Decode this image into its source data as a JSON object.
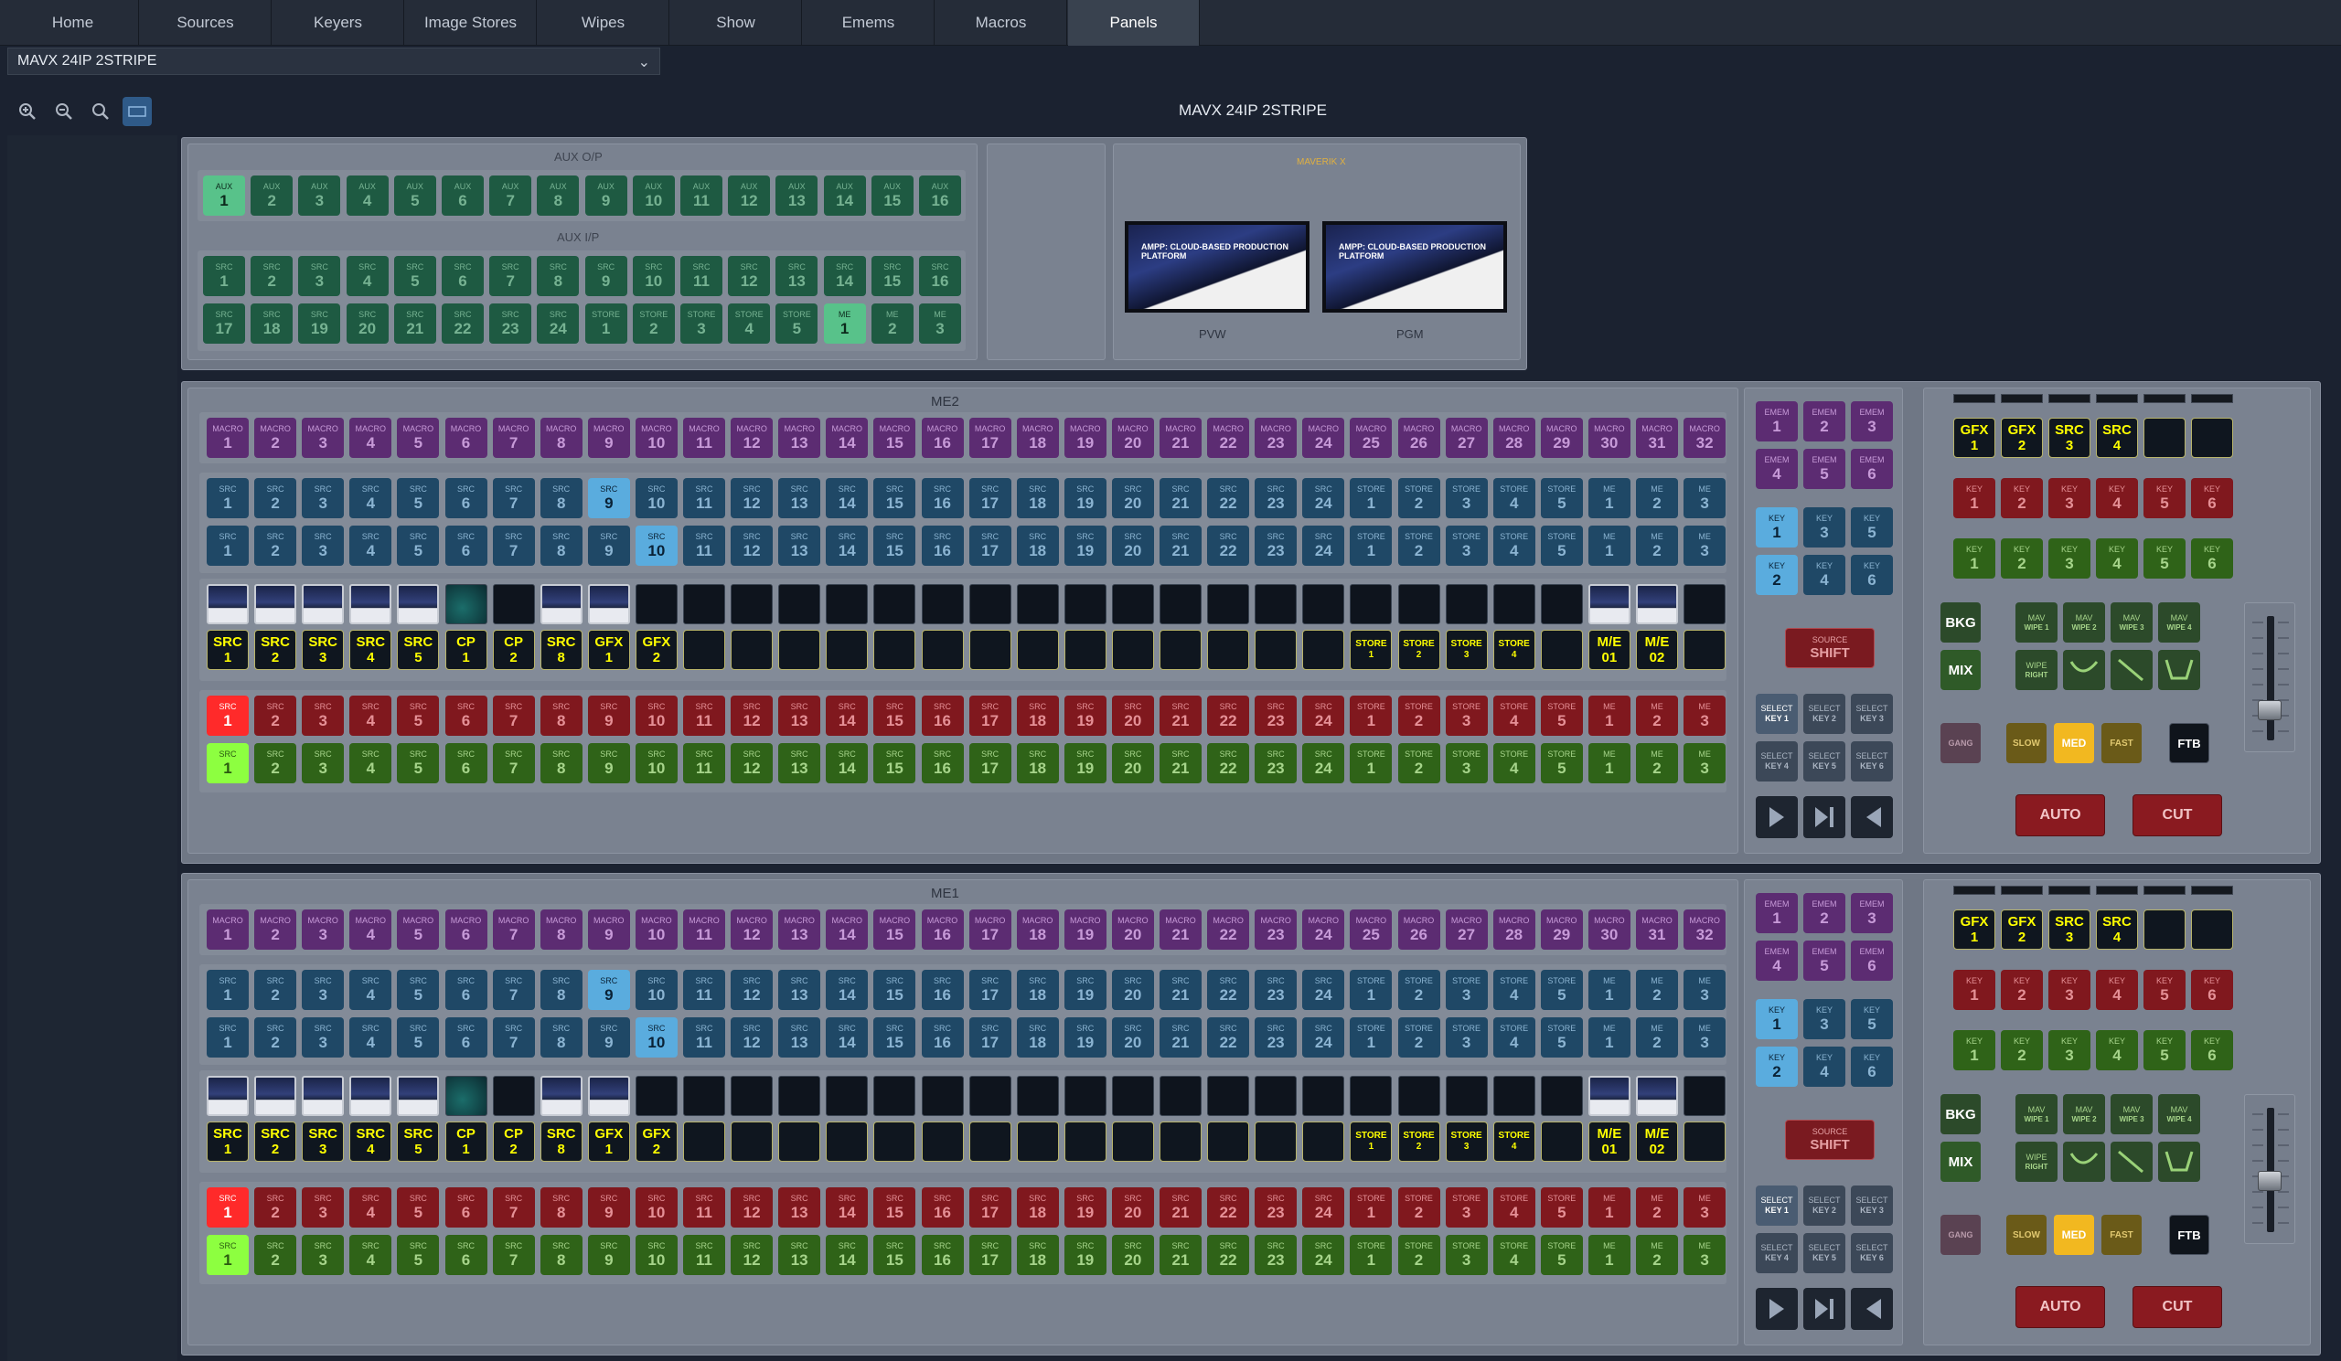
{
  "nav": {
    "tabs": [
      "Home",
      "Sources",
      "Keyers",
      "Image Stores",
      "Wipes",
      "Show",
      "Emems",
      "Macros",
      "Panels"
    ],
    "active": "Panels"
  },
  "panel_selector": {
    "value": "MAVX 24IP 2STRIPE"
  },
  "title": "MAVX 24IP 2STRIPE",
  "zoom_icons": [
    "zoom-in-icon",
    "zoom-out-icon",
    "zoom-reset-icon",
    "fit-icon"
  ],
  "aux": {
    "out_label": "AUX O/P",
    "in_label": "AUX I/P",
    "out_buttons": [
      [
        "AUX",
        "1"
      ],
      [
        "AUX",
        "2"
      ],
      [
        "AUX",
        "3"
      ],
      [
        "AUX",
        "4"
      ],
      [
        "AUX",
        "5"
      ],
      [
        "AUX",
        "6"
      ],
      [
        "AUX",
        "7"
      ],
      [
        "AUX",
        "8"
      ],
      [
        "AUX",
        "9"
      ],
      [
        "AUX",
        "10"
      ],
      [
        "AUX",
        "11"
      ],
      [
        "AUX",
        "12"
      ],
      [
        "AUX",
        "13"
      ],
      [
        "AUX",
        "14"
      ],
      [
        "AUX",
        "15"
      ],
      [
        "AUX",
        "16"
      ]
    ],
    "in_row1": [
      [
        "SRC",
        "1"
      ],
      [
        "SRC",
        "2"
      ],
      [
        "SRC",
        "3"
      ],
      [
        "SRC",
        "4"
      ],
      [
        "SRC",
        "5"
      ],
      [
        "SRC",
        "6"
      ],
      [
        "SRC",
        "7"
      ],
      [
        "SRC",
        "8"
      ],
      [
        "SRC",
        "9"
      ],
      [
        "SRC",
        "10"
      ],
      [
        "SRC",
        "11"
      ],
      [
        "SRC",
        "12"
      ],
      [
        "SRC",
        "13"
      ],
      [
        "SRC",
        "14"
      ],
      [
        "SRC",
        "15"
      ],
      [
        "SRC",
        "16"
      ]
    ],
    "in_row2": [
      [
        "SRC",
        "17"
      ],
      [
        "SRC",
        "18"
      ],
      [
        "SRC",
        "19"
      ],
      [
        "SRC",
        "20"
      ],
      [
        "SRC",
        "21"
      ],
      [
        "SRC",
        "22"
      ],
      [
        "SRC",
        "23"
      ],
      [
        "SRC",
        "24"
      ],
      [
        "STORE",
        "1"
      ],
      [
        "STORE",
        "2"
      ],
      [
        "STORE",
        "3"
      ],
      [
        "STORE",
        "4"
      ],
      [
        "STORE",
        "5"
      ],
      [
        "ME",
        "1"
      ],
      [
        "ME",
        "2"
      ],
      [
        "ME",
        "3"
      ]
    ],
    "out_selected": 0,
    "in_selected": 13
  },
  "maverik": {
    "label": "MAVERIK X",
    "pvw": "PVW",
    "pgm": "PGM",
    "thumb_text": "AMPP: CLOUD-BASED PRODUCTION PLATFORM"
  },
  "mes": [
    {
      "label": "ME2",
      "macros": [
        [
          "MACRO",
          "1"
        ],
        [
          "MACRO",
          "2"
        ],
        [
          "MACRO",
          "3"
        ],
        [
          "MACRO",
          "4"
        ],
        [
          "MACRO",
          "5"
        ],
        [
          "MACRO",
          "6"
        ],
        [
          "MACRO",
          "7"
        ],
        [
          "MACRO",
          "8"
        ],
        [
          "MACRO",
          "9"
        ],
        [
          "MACRO",
          "10"
        ],
        [
          "MACRO",
          "11"
        ],
        [
          "MACRO",
          "12"
        ],
        [
          "MACRO",
          "13"
        ],
        [
          "MACRO",
          "14"
        ],
        [
          "MACRO",
          "15"
        ],
        [
          "MACRO",
          "16"
        ],
        [
          "MACRO",
          "17"
        ],
        [
          "MACRO",
          "18"
        ],
        [
          "MACRO",
          "19"
        ],
        [
          "MACRO",
          "20"
        ],
        [
          "MACRO",
          "21"
        ],
        [
          "MACRO",
          "22"
        ],
        [
          "MACRO",
          "23"
        ],
        [
          "MACRO",
          "24"
        ],
        [
          "MACRO",
          "25"
        ],
        [
          "MACRO",
          "26"
        ],
        [
          "MACRO",
          "27"
        ],
        [
          "MACRO",
          "28"
        ],
        [
          "MACRO",
          "29"
        ],
        [
          "MACRO",
          "30"
        ],
        [
          "MACRO",
          "31"
        ],
        [
          "MACRO",
          "32"
        ]
      ],
      "bus": [
        [
          "SRC",
          "1"
        ],
        [
          "SRC",
          "2"
        ],
        [
          "SRC",
          "3"
        ],
        [
          "SRC",
          "4"
        ],
        [
          "SRC",
          "5"
        ],
        [
          "SRC",
          "6"
        ],
        [
          "SRC",
          "7"
        ],
        [
          "SRC",
          "8"
        ],
        [
          "SRC",
          "9"
        ],
        [
          "SRC",
          "10"
        ],
        [
          "SRC",
          "11"
        ],
        [
          "SRC",
          "12"
        ],
        [
          "SRC",
          "13"
        ],
        [
          "SRC",
          "14"
        ],
        [
          "SRC",
          "15"
        ],
        [
          "SRC",
          "16"
        ],
        [
          "SRC",
          "17"
        ],
        [
          "SRC",
          "18"
        ],
        [
          "SRC",
          "19"
        ],
        [
          "SRC",
          "20"
        ],
        [
          "SRC",
          "21"
        ],
        [
          "SRC",
          "22"
        ],
        [
          "SRC",
          "23"
        ],
        [
          "SRC",
          "24"
        ],
        [
          "STORE",
          "1"
        ],
        [
          "STORE",
          "2"
        ],
        [
          "STORE",
          "3"
        ],
        [
          "STORE",
          "4"
        ],
        [
          "STORE",
          "5"
        ],
        [
          "ME",
          "1"
        ],
        [
          "ME",
          "2"
        ],
        [
          "ME",
          "3"
        ]
      ],
      "key1_selected": 8,
      "key2_selected": 9,
      "thumbs": [
        "img",
        "img",
        "img",
        "img",
        "img",
        "teal",
        "",
        "img",
        "img",
        "",
        "",
        "",
        "",
        "",
        "",
        "",
        "",
        "",
        "",
        "",
        "",
        "",
        "",
        "",
        "",
        "",
        "",
        "",
        "",
        "img",
        "img",
        ""
      ],
      "labels": [
        [
          "SRC",
          "1"
        ],
        [
          "SRC",
          "2"
        ],
        [
          "SRC",
          "3"
        ],
        [
          "SRC",
          "4"
        ],
        [
          "SRC",
          "5"
        ],
        [
          "CP",
          "1"
        ],
        [
          "CP",
          "2"
        ],
        [
          "SRC",
          "8"
        ],
        [
          "GFX",
          "1"
        ],
        [
          "GFX",
          "2"
        ],
        [
          "",
          ""
        ],
        [
          "",
          ""
        ],
        [
          "",
          ""
        ],
        [
          "",
          ""
        ],
        [
          "",
          ""
        ],
        [
          "",
          ""
        ],
        [
          "",
          ""
        ],
        [
          "",
          ""
        ],
        [
          "",
          ""
        ],
        [
          "",
          ""
        ],
        [
          "",
          ""
        ],
        [
          "",
          ""
        ],
        [
          "",
          ""
        ],
        [
          "",
          ""
        ],
        [
          "STORE",
          "1"
        ],
        [
          "STORE",
          "2"
        ],
        [
          "STORE",
          "3"
        ],
        [
          "STORE",
          "4"
        ],
        [
          "",
          ""
        ],
        [
          "M/E",
          "01"
        ],
        [
          "M/E",
          "02"
        ],
        [
          "",
          ""
        ]
      ],
      "emem": [
        [
          "EMEM",
          "1"
        ],
        [
          "EMEM",
          "2"
        ],
        [
          "EMEM",
          "3"
        ],
        [
          "EMEM",
          "4"
        ],
        [
          "EMEM",
          "5"
        ],
        [
          "EMEM",
          "6"
        ]
      ],
      "keys": [
        [
          "KEY",
          "1"
        ],
        [
          "KEY",
          "3"
        ],
        [
          "KEY",
          "5"
        ],
        [
          "KEY",
          "2"
        ],
        [
          "KEY",
          "4"
        ],
        [
          "KEY",
          "6"
        ]
      ],
      "shift": [
        "SOURCE",
        "SHIFT"
      ],
      "select_keys": [
        [
          "SELECT",
          "KEY 1"
        ],
        [
          "SELECT",
          "KEY 2"
        ],
        [
          "SELECT",
          "KEY 3"
        ],
        [
          "SELECT",
          "KEY 4"
        ],
        [
          "SELECT",
          "KEY 5"
        ],
        [
          "SELECT",
          "KEY 6"
        ]
      ],
      "top_row": [
        [
          "GFX",
          "1"
        ],
        [
          "GFX",
          "2"
        ],
        [
          "SRC",
          "3"
        ],
        [
          "SRC",
          "4"
        ],
        [
          "",
          ""
        ],
        [
          "",
          ""
        ]
      ],
      "key_red": [
        [
          "KEY",
          "1"
        ],
        [
          "KEY",
          "2"
        ],
        [
          "KEY",
          "3"
        ],
        [
          "KEY",
          "4"
        ],
        [
          "KEY",
          "5"
        ],
        [
          "KEY",
          "6"
        ]
      ],
      "key_green": [
        [
          "KEY",
          "1"
        ],
        [
          "KEY",
          "2"
        ],
        [
          "KEY",
          "3"
        ],
        [
          "KEY",
          "4"
        ],
        [
          "KEY",
          "5"
        ],
        [
          "KEY",
          "6"
        ]
      ],
      "bkg": "BKG",
      "mix": "MIX",
      "mav_wipes": [
        [
          "MAV",
          "WIPE 1"
        ],
        [
          "MAV",
          "WIPE 2"
        ],
        [
          "MAV",
          "WIPE 3"
        ],
        [
          "MAV",
          "WIPE 4"
        ]
      ],
      "wipe_right": [
        "WIPE",
        "RIGHT"
      ],
      "gang": "GANG",
      "slow": "SLOW",
      "med": "MED",
      "fast": "FAST",
      "ftb": "FTB",
      "auto": "AUTO",
      "cut": "CUT",
      "fader_level": 0.2
    },
    {
      "label": "ME1",
      "macros": [
        [
          "MACRO",
          "1"
        ],
        [
          "MACRO",
          "2"
        ],
        [
          "MACRO",
          "3"
        ],
        [
          "MACRO",
          "4"
        ],
        [
          "MACRO",
          "5"
        ],
        [
          "MACRO",
          "6"
        ],
        [
          "MACRO",
          "7"
        ],
        [
          "MACRO",
          "8"
        ],
        [
          "MACRO",
          "9"
        ],
        [
          "MACRO",
          "10"
        ],
        [
          "MACRO",
          "11"
        ],
        [
          "MACRO",
          "12"
        ],
        [
          "MACRO",
          "13"
        ],
        [
          "MACRO",
          "14"
        ],
        [
          "MACRO",
          "15"
        ],
        [
          "MACRO",
          "16"
        ],
        [
          "MACRO",
          "17"
        ],
        [
          "MACRO",
          "18"
        ],
        [
          "MACRO",
          "19"
        ],
        [
          "MACRO",
          "20"
        ],
        [
          "MACRO",
          "21"
        ],
        [
          "MACRO",
          "22"
        ],
        [
          "MACRO",
          "23"
        ],
        [
          "MACRO",
          "24"
        ],
        [
          "MACRO",
          "25"
        ],
        [
          "MACRO",
          "26"
        ],
        [
          "MACRO",
          "27"
        ],
        [
          "MACRO",
          "28"
        ],
        [
          "MACRO",
          "29"
        ],
        [
          "MACRO",
          "30"
        ],
        [
          "MACRO",
          "31"
        ],
        [
          "MACRO",
          "32"
        ]
      ],
      "bus": [
        [
          "SRC",
          "1"
        ],
        [
          "SRC",
          "2"
        ],
        [
          "SRC",
          "3"
        ],
        [
          "SRC",
          "4"
        ],
        [
          "SRC",
          "5"
        ],
        [
          "SRC",
          "6"
        ],
        [
          "SRC",
          "7"
        ],
        [
          "SRC",
          "8"
        ],
        [
          "SRC",
          "9"
        ],
        [
          "SRC",
          "10"
        ],
        [
          "SRC",
          "11"
        ],
        [
          "SRC",
          "12"
        ],
        [
          "SRC",
          "13"
        ],
        [
          "SRC",
          "14"
        ],
        [
          "SRC",
          "15"
        ],
        [
          "SRC",
          "16"
        ],
        [
          "SRC",
          "17"
        ],
        [
          "SRC",
          "18"
        ],
        [
          "SRC",
          "19"
        ],
        [
          "SRC",
          "20"
        ],
        [
          "SRC",
          "21"
        ],
        [
          "SRC",
          "22"
        ],
        [
          "SRC",
          "23"
        ],
        [
          "SRC",
          "24"
        ],
        [
          "STORE",
          "1"
        ],
        [
          "STORE",
          "2"
        ],
        [
          "STORE",
          "3"
        ],
        [
          "STORE",
          "4"
        ],
        [
          "STORE",
          "5"
        ],
        [
          "ME",
          "1"
        ],
        [
          "ME",
          "2"
        ],
        [
          "ME",
          "3"
        ]
      ],
      "key1_selected": 8,
      "key2_selected": 9,
      "thumbs": [
        "img",
        "img",
        "img",
        "img",
        "img",
        "teal",
        "",
        "img",
        "img",
        "",
        "",
        "",
        "",
        "",
        "",
        "",
        "",
        "",
        "",
        "",
        "",
        "",
        "",
        "",
        "",
        "",
        "",
        "",
        "",
        "img",
        "img",
        ""
      ],
      "labels": [
        [
          "SRC",
          "1"
        ],
        [
          "SRC",
          "2"
        ],
        [
          "SRC",
          "3"
        ],
        [
          "SRC",
          "4"
        ],
        [
          "SRC",
          "5"
        ],
        [
          "CP",
          "1"
        ],
        [
          "CP",
          "2"
        ],
        [
          "SRC",
          "8"
        ],
        [
          "GFX",
          "1"
        ],
        [
          "GFX",
          "2"
        ],
        [
          "",
          ""
        ],
        [
          "",
          ""
        ],
        [
          "",
          ""
        ],
        [
          "",
          ""
        ],
        [
          "",
          ""
        ],
        [
          "",
          ""
        ],
        [
          "",
          ""
        ],
        [
          "",
          ""
        ],
        [
          "",
          ""
        ],
        [
          "",
          ""
        ],
        [
          "",
          ""
        ],
        [
          "",
          ""
        ],
        [
          "",
          ""
        ],
        [
          "",
          ""
        ],
        [
          "STORE",
          "1"
        ],
        [
          "STORE",
          "2"
        ],
        [
          "STORE",
          "3"
        ],
        [
          "STORE",
          "4"
        ],
        [
          "",
          ""
        ],
        [
          "M/E",
          "01"
        ],
        [
          "M/E",
          "02"
        ],
        [
          "",
          ""
        ]
      ],
      "emem": [
        [
          "EMEM",
          "1"
        ],
        [
          "EMEM",
          "2"
        ],
        [
          "EMEM",
          "3"
        ],
        [
          "EMEM",
          "4"
        ],
        [
          "EMEM",
          "5"
        ],
        [
          "EMEM",
          "6"
        ]
      ],
      "keys": [
        [
          "KEY",
          "1"
        ],
        [
          "KEY",
          "3"
        ],
        [
          "KEY",
          "5"
        ],
        [
          "KEY",
          "2"
        ],
        [
          "KEY",
          "4"
        ],
        [
          "KEY",
          "6"
        ]
      ],
      "shift": [
        "SOURCE",
        "SHIFT"
      ],
      "select_keys": [
        [
          "SELECT",
          "KEY 1"
        ],
        [
          "SELECT",
          "KEY 2"
        ],
        [
          "SELECT",
          "KEY 3"
        ],
        [
          "SELECT",
          "KEY 4"
        ],
        [
          "SELECT",
          "KEY 5"
        ],
        [
          "SELECT",
          "KEY 6"
        ]
      ],
      "top_row": [
        [
          "GFX",
          "1"
        ],
        [
          "GFX",
          "2"
        ],
        [
          "SRC",
          "3"
        ],
        [
          "SRC",
          "4"
        ],
        [
          "",
          ""
        ],
        [
          "",
          ""
        ]
      ],
      "key_red": [
        [
          "KEY",
          "1"
        ],
        [
          "KEY",
          "2"
        ],
        [
          "KEY",
          "3"
        ],
        [
          "KEY",
          "4"
        ],
        [
          "KEY",
          "5"
        ],
        [
          "KEY",
          "6"
        ]
      ],
      "key_green": [
        [
          "KEY",
          "1"
        ],
        [
          "KEY",
          "2"
        ],
        [
          "KEY",
          "3"
        ],
        [
          "KEY",
          "4"
        ],
        [
          "KEY",
          "5"
        ],
        [
          "KEY",
          "6"
        ]
      ],
      "bkg": "BKG",
      "mix": "MIX",
      "mav_wipes": [
        [
          "MAV",
          "WIPE 1"
        ],
        [
          "MAV",
          "WIPE 2"
        ],
        [
          "MAV",
          "WIPE 3"
        ],
        [
          "MAV",
          "WIPE 4"
        ]
      ],
      "wipe_right": [
        "WIPE",
        "RIGHT"
      ],
      "gang": "GANG",
      "slow": "SLOW",
      "med": "MED",
      "fast": "FAST",
      "ftb": "FTB",
      "auto": "AUTO",
      "cut": "CUT",
      "fader_level": 0.4
    }
  ],
  "colors": {
    "aux": "#1e5a42",
    "aux_on": "#58c28a",
    "macro": "#5c2c72",
    "bus": "#1f4866",
    "bus_on": "#5aacde",
    "pgm": "#80181e",
    "pgm_on": "#ff2a2a",
    "pvw": "#2f6318",
    "pvw_on": "#8dff40",
    "label_bg": "#0f161f",
    "key_sel": "#5aacde",
    "select": "#3a4a5e",
    "amber": "#6a5a18",
    "med_on": "#f2b820",
    "auto": "#8a1a20",
    "ftb": "#0f141b"
  }
}
